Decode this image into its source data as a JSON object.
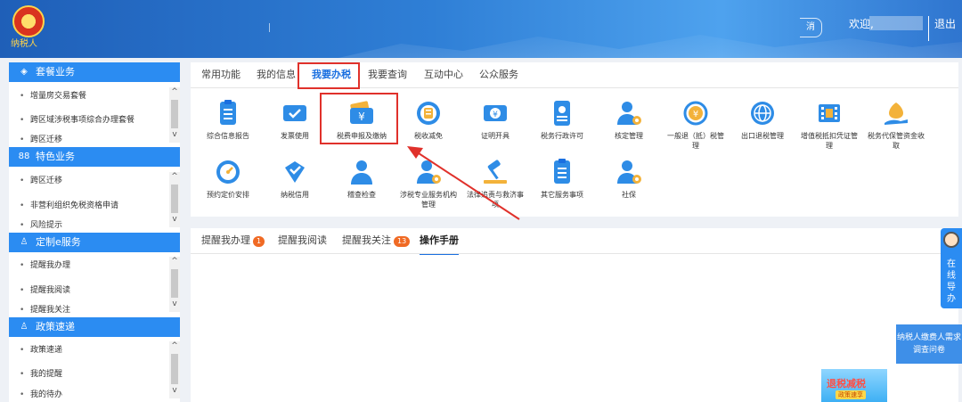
{
  "header": {
    "logo_text": "纳税人",
    "welcome": "欢迎,",
    "logout": "退出",
    "bell_label": "消"
  },
  "sidebar": {
    "sections": [
      {
        "title": "套餐业务",
        "items": [
          "增量房交易套餐",
          "跨区域涉税事项综合办理套餐",
          "跨区迁移"
        ]
      },
      {
        "title": "特色业务",
        "items": [
          "跨区迁移",
          "非营利组织免税资格申请",
          "风险提示"
        ]
      },
      {
        "title": "定制e服务",
        "items": [
          "提醒我办理",
          "提醒我阅读",
          "提醒我关注"
        ]
      },
      {
        "title": "政策速递",
        "items": [
          "政策速递",
          "我的提醒",
          "我的待办"
        ]
      }
    ]
  },
  "main": {
    "tabs": [
      "常用功能",
      "我的信息",
      "我要办税",
      "我要查询",
      "互动中心",
      "公众服务"
    ],
    "active_tab": "我要办税",
    "functions_row1": [
      "综合信息报告",
      "发票使用",
      "税费申报及缴纳",
      "税收减免",
      "证明开具",
      "税务行政许可",
      "核定管理",
      "一般退（抵）税管理",
      "出口退税管理",
      "增值税抵扣凭证管理",
      "税务代保管资金收取"
    ],
    "functions_row2": [
      "预约定价安排",
      "纳税信用",
      "稽查检查",
      "涉税专业服务机构管理",
      "法律追责与救济事项",
      "其它服务事项",
      "社保"
    ],
    "highlighted": "税费申报及缴纳",
    "accent_color": "#1a6fe0",
    "highlight_color": "#e0312b"
  },
  "lower": {
    "tabs": [
      {
        "label": "提醒我办理",
        "badge": "1"
      },
      {
        "label": "提醒我阅读",
        "badge": ""
      },
      {
        "label": "提醒我关注",
        "badge": "13"
      },
      {
        "label": "操作手册",
        "badge": ""
      }
    ],
    "active_tab": "操作手册"
  },
  "float": {
    "online_service": "在线导办",
    "survey": "纳税人缴费人需求调查问卷",
    "promo_big": "退税减税",
    "promo_small": "政策速享"
  }
}
